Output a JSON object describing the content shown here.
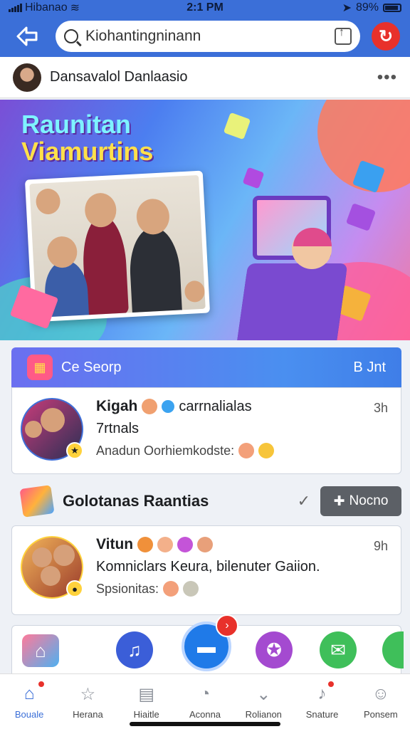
{
  "status_bar": {
    "carrier": "Hibanao",
    "time": "2:1 PM",
    "battery": "89%"
  },
  "top_bar": {
    "search_value": "Kiohantingninann"
  },
  "profile": {
    "name": "Dansavalol Danlaasio"
  },
  "banner": {
    "title_line1": "Raunitan",
    "title_line2": "Viamurtins"
  },
  "section": {
    "title": "Ce Seorp",
    "right_label": "B Jnt"
  },
  "post1": {
    "title": "Kigah",
    "tag": "carrnalialas",
    "line": "7rtnals",
    "meta": "Anadun Oorhiemkodste:",
    "time": "3h"
  },
  "group": {
    "title": "Golotanas Raantias",
    "button_label": "Nocno"
  },
  "post2": {
    "title": "Vitun",
    "line": "Komniclars Keura, bilenuter Gaiion.",
    "meta": "Spsionitas:",
    "time": "9h"
  },
  "tabs": [
    {
      "label": "Bouale",
      "icon": "home-icon"
    },
    {
      "label": "Herana",
      "icon": "star-icon"
    },
    {
      "label": "Hiaitle",
      "icon": "calendar-icon"
    },
    {
      "label": "Aconna",
      "icon": "compass-icon"
    },
    {
      "label": "Rolianon",
      "icon": "chevron-down-circle-icon"
    },
    {
      "label": "Snature",
      "icon": "bell-icon"
    },
    {
      "label": "Ponsem",
      "icon": "person-icon"
    }
  ],
  "colors": {
    "brand_blue": "#3b6fd8",
    "alert_red": "#e8312b"
  }
}
